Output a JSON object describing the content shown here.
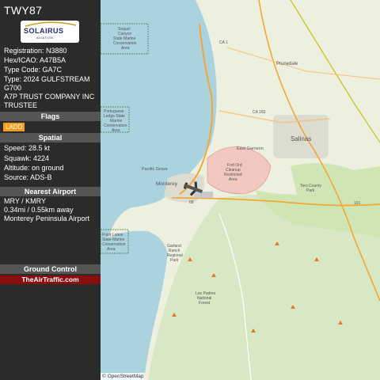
{
  "aircraft": {
    "callsign": "TWY87",
    "logo_text": "SOLAIRUS",
    "logo_subtext": "AVIATION",
    "registration": "Registration: N3880",
    "hex": "Hex/ICAO: A47B5A",
    "type_code": "Type Code: GA7C",
    "type_line1": "Type: 2024 GULFSTREAM",
    "type_line2": "G700",
    "owner_line1": "A7P TRUST COMPANY INC",
    "owner_line2": "TRUSTEE"
  },
  "sections": {
    "flags": "Flags",
    "spatial": "Spatial",
    "nearest_airport": "Nearest Airport",
    "ground_control": "Ground Control"
  },
  "flags": [
    "LADD"
  ],
  "spatial": {
    "speed": "Speed: 28.5 kt",
    "squawk": "Squawk: 4224",
    "altitude": "Altitude: on ground",
    "source": "Source: ADS-B"
  },
  "nearest_airport": {
    "code": "MRY / KMRY",
    "distance": "0.34mi / 0.55km away",
    "name": "Monterey Peninsula Airport"
  },
  "ground_control": {
    "website": "TheAirTraffic.com"
  },
  "map": {
    "attribution": "© OpenStreetMap",
    "labels": {
      "soquel": [
        "Soquel",
        "Canyon",
        "State Marine",
        "Conservation",
        "Area"
      ],
      "portuguese": [
        "Portuguese",
        "Ledge State",
        "Marine",
        "Conservation",
        "Area"
      ],
      "point_lobos": [
        "Point Lobos",
        "State Marine",
        "Conservation",
        "Area"
      ],
      "fort_ord": [
        "Fort Ord",
        "Cleanup",
        "Restricted",
        "Area"
      ],
      "toro": [
        "Toro County",
        "Park"
      ],
      "garland": [
        "Garland",
        "Ranch",
        "Regional",
        "Park"
      ],
      "los_padres": [
        "Los Padres",
        "National",
        "Forest"
      ],
      "prunedale": "Prunedale",
      "salinas": "Salinas",
      "east_garrison": "East Garrison",
      "pacific_grove": "Pacific Grove",
      "monterey": "Monterey",
      "ca1": "CA 1",
      "ca183": "CA 183",
      "r101": "101",
      "r68": "68"
    }
  },
  "colors": {
    "sidebar_bg": "#2b2b2b",
    "header_bg": "#555555",
    "flag_ladd": "#f59c1a",
    "website_bg": "#8b0e0e",
    "ocean": "#aad3df",
    "land": "#eef0df",
    "park_green": "#cfe6b4",
    "restricted": "#f2c7c0",
    "highway": "#f3a73a",
    "state_border": "#c8c830"
  }
}
